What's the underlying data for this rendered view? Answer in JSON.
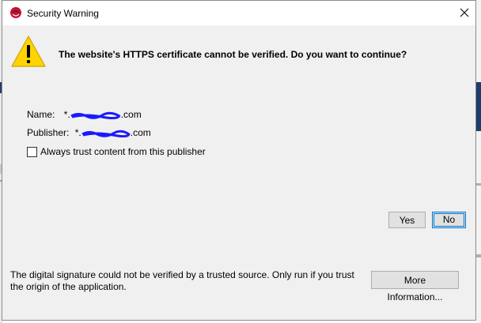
{
  "window": {
    "title": "Security Warning",
    "app_icon": "java-coffee-cup-icon",
    "close_icon": "close-icon"
  },
  "warning": {
    "icon": "warning-triangle-icon",
    "headline": "The website's HTTPS certificate cannot be verified. Do you want to continue?"
  },
  "details": {
    "name_label": "Name:",
    "name_prefix": "*.",
    "name_suffix": ".com",
    "publisher_label": "Publisher:",
    "publisher_prefix": "*.",
    "publisher_suffix": ".com"
  },
  "trust": {
    "label": "Always trust content from this publisher",
    "checked": false
  },
  "buttons": {
    "yes": "Yes",
    "no": "No",
    "more_info": "More Information..."
  },
  "footer": {
    "message": "The digital signature could not be verified by a trusted source. Only run if you trust the origin of the application."
  },
  "colors": {
    "dialog_bg": "#f0f0f0",
    "focus_border": "#0078d7",
    "redaction": "#1a1aff",
    "warning_fill": "#ffd400"
  }
}
